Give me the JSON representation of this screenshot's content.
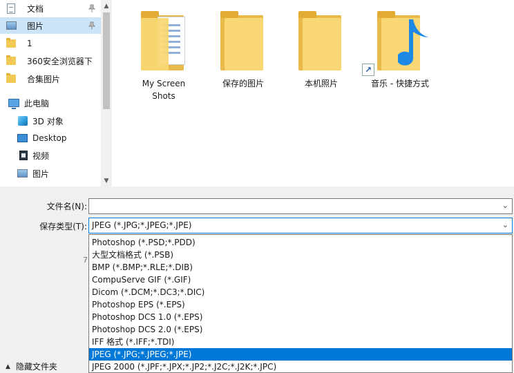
{
  "navigation": {
    "items": [
      {
        "label": "文档",
        "icon": "document-icon",
        "pinned": true
      },
      {
        "label": "图片",
        "icon": "pictures-icon",
        "pinned": true,
        "selected": true
      },
      {
        "label": "1",
        "icon": "folder-icon"
      },
      {
        "label": "360安全浏览器下",
        "icon": "folder-icon"
      },
      {
        "label": "合集图片",
        "icon": "folder-icon"
      },
      {
        "label": "此电脑",
        "icon": "this-pc-icon"
      },
      {
        "label": "3D 对象",
        "icon": "3d-objects-icon"
      },
      {
        "label": "Desktop",
        "icon": "desktop-icon"
      },
      {
        "label": "视频",
        "icon": "videos-icon"
      },
      {
        "label": "图片",
        "icon": "pictures-icon"
      }
    ]
  },
  "files": {
    "items": [
      {
        "name": "My Screen Shots",
        "icon": "folder-with-document-icon"
      },
      {
        "name": "保存的图片",
        "icon": "folder-icon"
      },
      {
        "name": "本机照片",
        "icon": "folder-icon"
      },
      {
        "name": "音乐 - 快捷方式",
        "icon": "music-shortcut-icon"
      }
    ]
  },
  "save_form": {
    "filename_label": "文件名(N):",
    "filename_value": "",
    "type_label": "保存类型(T):",
    "type_value": "JPEG (*.JPG;*.JPEG;*.JPE)"
  },
  "type_options": [
    "Photoshop (*.PSD;*.PDD)",
    "大型文档格式 (*.PSB)",
    "BMP (*.BMP;*.RLE;*.DIB)",
    "CompuServe GIF (*.GIF)",
    "Dicom (*.DCM;*.DC3;*.DIC)",
    "Photoshop EPS (*.EPS)",
    "Photoshop DCS 1.0 (*.EPS)",
    "Photoshop DCS 2.0 (*.EPS)",
    "IFF 格式 (*.IFF;*.TDI)",
    "JPEG (*.JPG;*.JPEG;*.JPE)",
    "JPEG 2000 (*.JPF;*.JPX;*.JP2;*.J2C;*.J2K;*.JPC)"
  ],
  "selected_option": "JPEG (*.JPG;*.JPEG;*.JPE)",
  "hide_folders_label": "隐藏文件夹",
  "colors": {
    "selection": "#0078d7",
    "nav_selected": "#cce4f7",
    "folder": "#f8d774"
  }
}
